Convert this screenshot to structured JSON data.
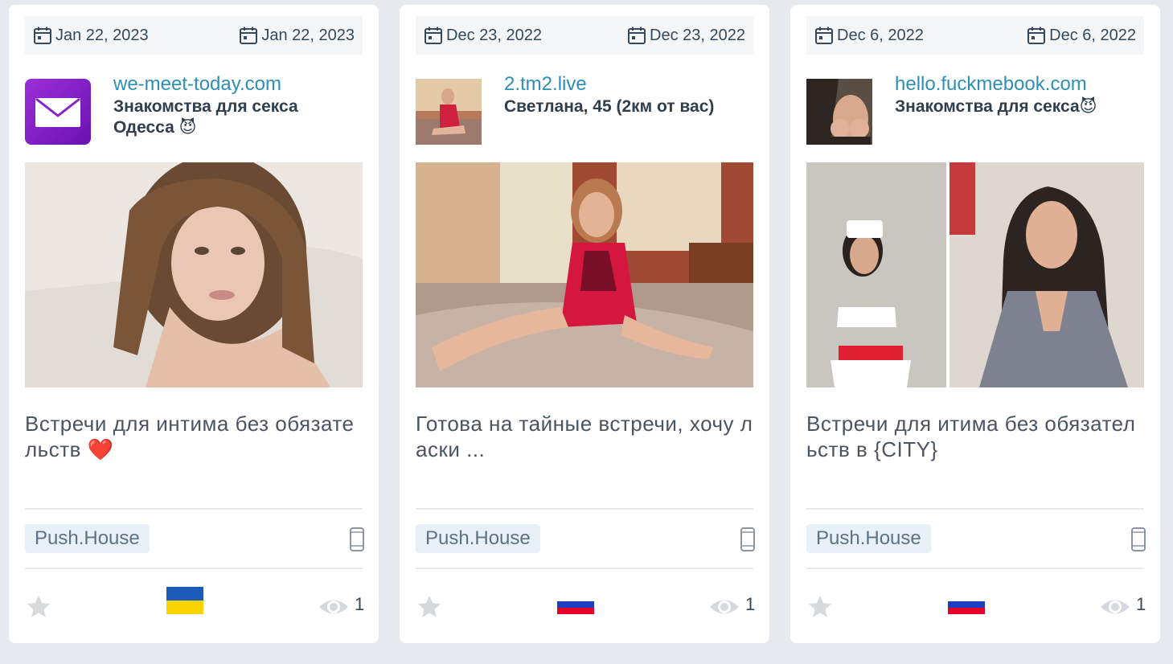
{
  "cards": [
    {
      "date_start": "Jan 22, 2023",
      "date_end": "Jan 22, 2023",
      "domain": "we-meet-today.com",
      "subtitle": "Знакомства для секса Одесса 😈",
      "description": "Встречи для интима без обязательств ❤️",
      "tag": "Push.House",
      "flag": "Ukraine",
      "views": "1",
      "thumb_icon": "mail-icon",
      "device_icon": "phone-icon"
    },
    {
      "date_start": "Dec 23, 2022",
      "date_end": "Dec 23, 2022",
      "domain": "2.tm2.live",
      "subtitle": "Светлана, 45 (2км от вас)",
      "description": "Готова на тайные встречи, хочу ласки ...",
      "tag": "Push.House",
      "flag": "Russia",
      "views": "1",
      "device_icon": "phone-icon"
    },
    {
      "date_start": "Dec 6, 2022",
      "date_end": "Dec 6, 2022",
      "domain": "hello.fuckmebook.com",
      "subtitle": "Знакомства для секса😈",
      "description": "Встречи для итима без обязательств в {CITY}",
      "tag": "Push.House",
      "flag": "Russia",
      "views": "1",
      "device_icon": "phone-icon"
    }
  ],
  "colors": {
    "accent": "#2e8fb5",
    "tag_bg": "#e8f1f7",
    "page_bg": "#e6e9ed"
  }
}
